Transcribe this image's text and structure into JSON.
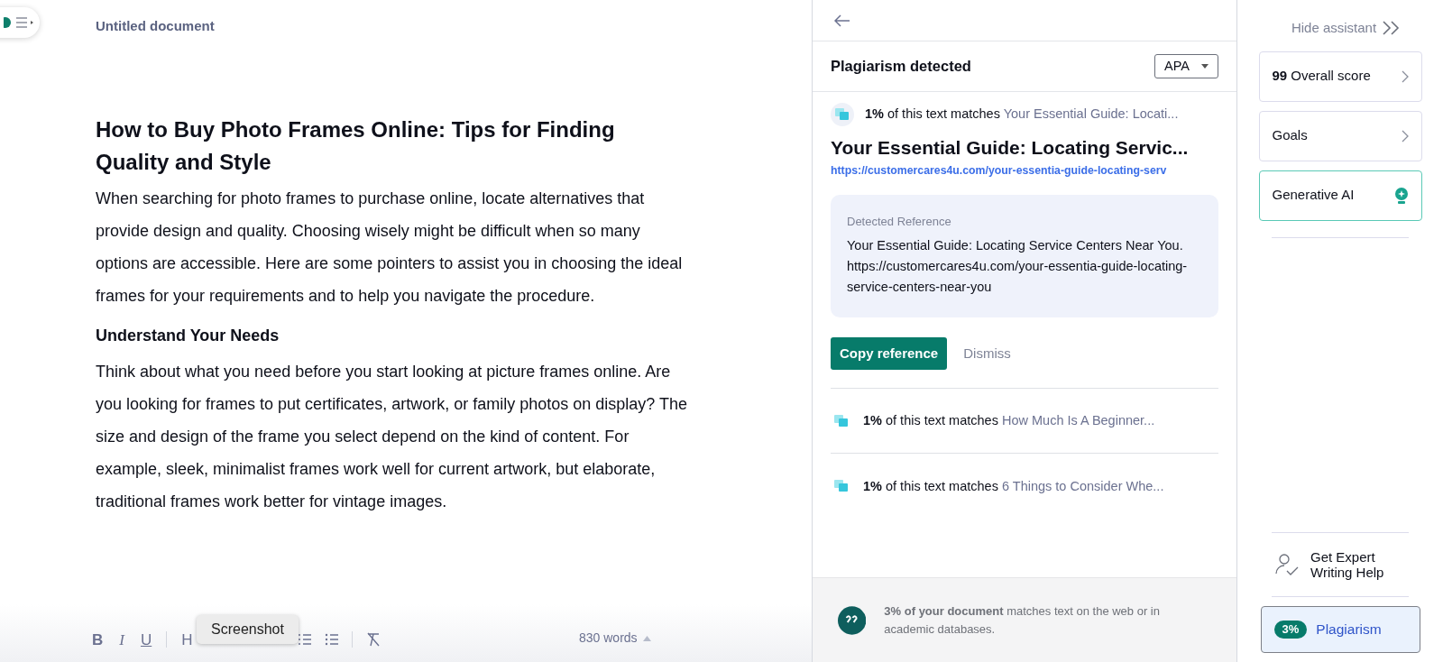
{
  "menu_toggle": {
    "expanded": false
  },
  "document": {
    "title": "Untitled document",
    "blocks": [
      {
        "kind": "heading1",
        "text": "How to Buy Photo Frames Online: Tips for Finding Quality and Style"
      },
      {
        "kind": "paragraph",
        "text": "When searching for photo frames to purchase online, locate alternatives that provide design and quality. Choosing wisely might be difficult when so many options are accessible. Here are some pointers to assist you in choosing the ideal frames for your requirements and to help you navigate the procedure."
      },
      {
        "kind": "heading2",
        "text": "Understand Your Needs"
      },
      {
        "kind": "paragraph",
        "text": "Think about what you need before you start looking at picture frames online. Are you looking for frames to put certificates, artwork, or family photos on display? The size and design of the frame you select depend on the kind of content. For example, sleek, minimalist frames work well for current artwork, but elaborate, traditional frames work better for vintage images."
      }
    ]
  },
  "toolbar": {
    "items": [
      {
        "kind": "bold",
        "label": "B"
      },
      {
        "kind": "italic",
        "label": "I"
      },
      {
        "kind": "underline",
        "label": "U"
      },
      {
        "kind": "divider"
      },
      {
        "kind": "heading",
        "label": "H"
      },
      {
        "kind": "ordered-list"
      },
      {
        "kind": "bullet-list"
      },
      {
        "kind": "divider"
      },
      {
        "kind": "clear-format"
      }
    ],
    "tooltip": "Screenshot",
    "word_count": "830 words"
  },
  "plagiarism_panel": {
    "title": "Plagiarism detected",
    "citation_style": "APA",
    "matches": [
      {
        "percent": "1%",
        "text": "of this text matches",
        "source": "Your Essential Guide: Locati...",
        "expanded": true,
        "source_title": "Your Essential Guide: Locating Servic...",
        "url": "https://customercares4u.com/your-essentia-guide-locating-serv",
        "reference_label": "Detected Reference",
        "reference": "Your Essential Guide: Locating Service Centers Near You. https://customercares4u.com/your-essentia-guide-locating-service-centers-near-you",
        "primary_action": "Copy reference",
        "secondary_action": "Dismiss"
      },
      {
        "percent": "1%",
        "text": "of this text matches",
        "source": "How Much Is A Beginner...",
        "expanded": false
      },
      {
        "percent": "1%",
        "text": "of this text matches",
        "source": "6 Things to Consider Whe...",
        "expanded": false
      }
    ],
    "summary": "**3% of your document** matches text on the web or in academic databases."
  },
  "assistant": {
    "hide_label": "Hide assistant",
    "cards": [
      {
        "kind": "nav",
        "score": "99",
        "label": "Overall score"
      },
      {
        "kind": "nav",
        "label": "Goals"
      },
      {
        "kind": "ai",
        "label": "Generative AI"
      }
    ],
    "expert_help": "Get Expert Writing Help",
    "plagiarism_button": {
      "percent": "3%",
      "label": "Plagiarism",
      "selected": true
    }
  }
}
